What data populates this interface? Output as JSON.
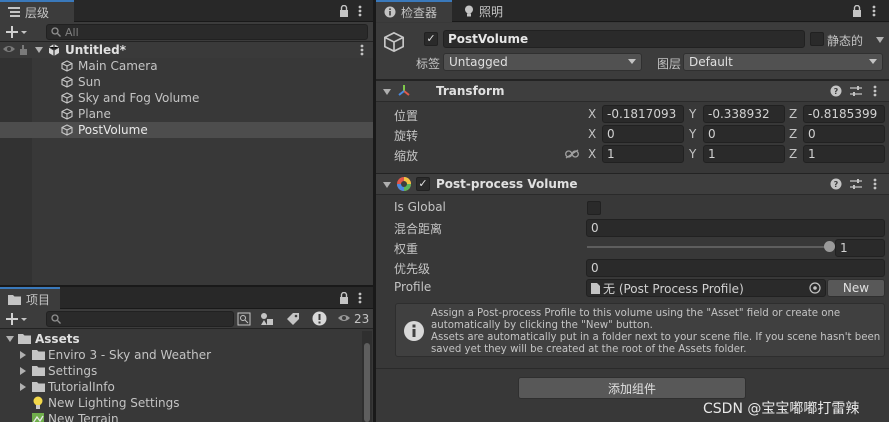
{
  "hierarchy": {
    "tab_label": "层级",
    "search_placeholder": "All",
    "scene_name": "Untitled*",
    "items": [
      {
        "label": "Main Camera"
      },
      {
        "label": "Sun"
      },
      {
        "label": "Sky and Fog Volume"
      },
      {
        "label": "Plane"
      },
      {
        "label": "PostVolume"
      }
    ]
  },
  "project": {
    "tab_label": "项目",
    "hidden_count": "23",
    "root": "Assets",
    "folders": [
      {
        "label": "Enviro 3 - Sky and Weather"
      },
      {
        "label": "Settings"
      },
      {
        "label": "TutorialInfo"
      }
    ],
    "assets": [
      {
        "label": "New Lighting Settings"
      },
      {
        "label": "New Terrain"
      }
    ]
  },
  "inspector": {
    "tabs": [
      {
        "label": "检查器"
      },
      {
        "label": "照明"
      }
    ],
    "object_name": "PostVolume",
    "static_label": "静态的",
    "tag_label": "标签",
    "tag_value": "Untagged",
    "layer_label": "图层",
    "layer_value": "Default",
    "transform": {
      "title": "Transform",
      "position_label": "位置",
      "rotation_label": "旋转",
      "scale_label": "缩放",
      "position": {
        "x": "-0.1817093",
        "y": "-0.338932",
        "z": "-0.8185399"
      },
      "rotation": {
        "x": "0",
        "y": "0",
        "z": "0"
      },
      "scale": {
        "x": "1",
        "y": "1",
        "z": "1"
      },
      "axis_x": "X",
      "axis_y": "Y",
      "axis_z": "Z"
    },
    "ppv": {
      "title": "Post-process Volume",
      "is_global_label": "Is Global",
      "blend_label": "混合距离",
      "blend_value": "0",
      "weight_label": "权重",
      "weight_value": "1",
      "weight_fraction": 1,
      "priority_label": "优先级",
      "priority_value": "0",
      "profile_label": "Profile",
      "profile_value": "无 (Post Process Profile)",
      "new_button": "New",
      "help_text": "Assign a Post-process Profile to this volume using the \"Asset\" field or create one automatically by clicking the \"New\" button.\nAssets are automatically put in a folder next to your scene file. If you scene hasn't been saved yet they will be created at the root of the Assets folder."
    },
    "add_component": "添加组件"
  },
  "watermark": "CSDN @宝宝嘟嘟打雷辣"
}
